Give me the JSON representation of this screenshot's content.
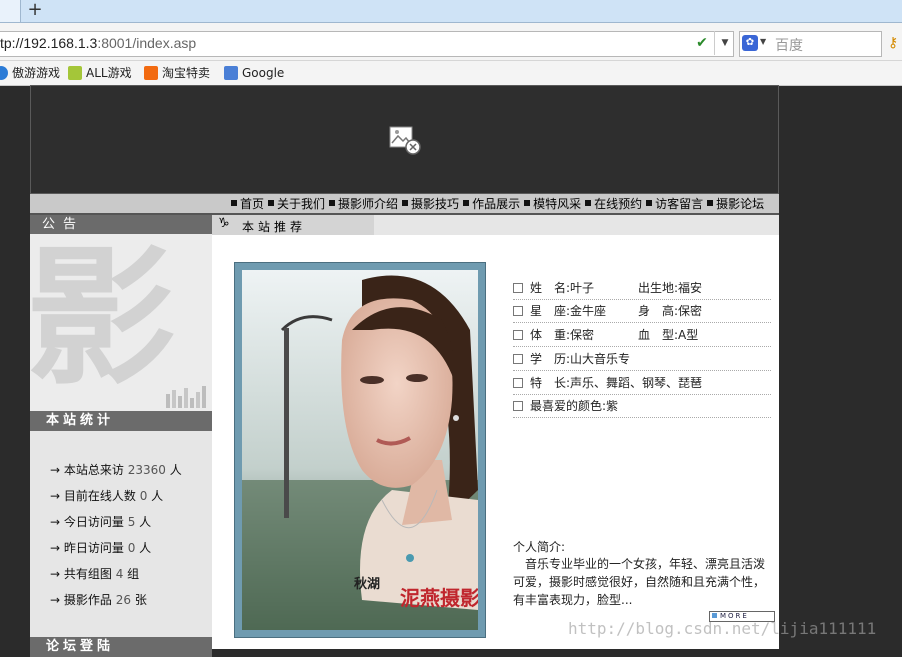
{
  "browser": {
    "new_tab": "+",
    "url_host": "tp://192.168.1.3",
    "url_port": ":8001",
    "url_path": "/index.asp",
    "search_placeholder": "百度",
    "bookmarks": [
      "傲游游戏",
      "ALL游戏",
      "淘宝特卖",
      "Google"
    ]
  },
  "nav": {
    "items": [
      "首页",
      "关于我们",
      "摄影师介绍",
      "摄影技巧",
      "作品展示",
      "模特风采",
      "在线预约",
      "访客留言",
      "摄影论坛"
    ]
  },
  "sidebar": {
    "notice_title": "公告",
    "deco_char": "影",
    "stats_title": "本站统计",
    "stats": [
      {
        "label": "→ 本站总来访",
        "value": "23360",
        "unit": "人"
      },
      {
        "label": "→ 目前在线人数",
        "value": "0",
        "unit": "人"
      },
      {
        "label": "→ 今日访问量",
        "value": "5",
        "unit": "人"
      },
      {
        "label": "→ 昨日访问量",
        "value": "0",
        "unit": "人"
      },
      {
        "label": "→ 共有组图",
        "value": "4",
        "unit": "组"
      },
      {
        "label": "→ 摄影作品",
        "value": "26",
        "unit": "张"
      }
    ],
    "forum_title": "论坛登陆"
  },
  "main": {
    "rec_icon": "♑",
    "rec_title": "本站推荐",
    "photo_caption": "秋湖",
    "photo_brand": "泥燕摄影",
    "profile": [
      {
        "left": "姓　名:叶子",
        "right": "出生地:福安"
      },
      {
        "left": "星　座:金牛座",
        "right": "身　高:保密"
      },
      {
        "left": "体　重:保密",
        "right": "血　型:A型"
      },
      {
        "left": "学　历:山大音乐专",
        "right": ""
      },
      {
        "left": "特　长:声乐、舞蹈、钢琴、琵琶",
        "right": ""
      },
      {
        "left": "最喜爱的颜色:紫",
        "right": ""
      }
    ],
    "bio_label": "个人简介:",
    "bio_text": "　音乐专业毕业的一个女孩，年轻、漂亮且活泼可爱，摄影时感觉很好，自然随和且充满个性，有丰富表现力，脸型...",
    "more_label": "MORE"
  },
  "watermark": "http://blog.csdn.net/lijia111111"
}
